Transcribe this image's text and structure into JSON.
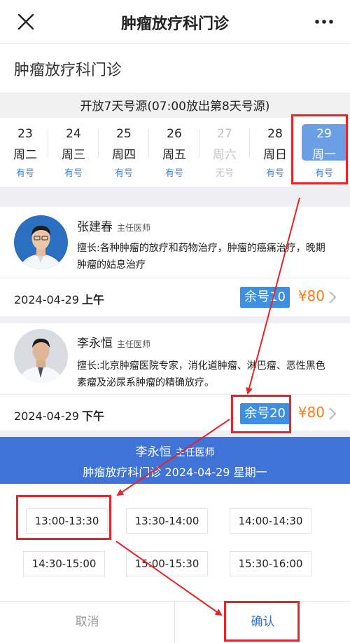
{
  "topbar": {
    "title": "肿瘤放疗科门诊"
  },
  "department": "肿瘤放疗科门诊",
  "notice": "开放7天号源(07:00放出第8天号源)",
  "days": [
    {
      "date": "23",
      "weekday": "周二",
      "status": "有号"
    },
    {
      "date": "24",
      "weekday": "周三",
      "status": "有号"
    },
    {
      "date": "25",
      "weekday": "周四",
      "status": "有号"
    },
    {
      "date": "26",
      "weekday": "周五",
      "status": "有号"
    },
    {
      "date": "27",
      "weekday": "周六",
      "status": "无号"
    },
    {
      "date": "28",
      "weekday": "周日",
      "status": "有号"
    },
    {
      "date": "29",
      "weekday": "周一",
      "status": "有号"
    }
  ],
  "doctors": [
    {
      "name": "张建春",
      "rank": "主任医师",
      "bio": "擅长:各种肿瘤的放疗和药物治疗，肿瘤的癌痛治疗，晚期肿瘤的姑息治疗",
      "date": "2024-04-29",
      "period": "上午",
      "remaining": "余号10",
      "price": "¥80"
    },
    {
      "name": "李永恒",
      "rank": "主任医师",
      "bio": "擅长:北京肿瘤医院专家，消化道肿瘤、淋巴瘤、恶性黑色素瘤及泌尿系肿瘤的精确放疗。",
      "date": "2024-04-29",
      "period": "下午",
      "remaining": "余号20",
      "price": "¥80"
    }
  ],
  "banner": {
    "name": "李永恒",
    "rank": "主任医师",
    "line2": "肿瘤放疗科门诊  2024-04-29  星期一"
  },
  "timeslots": [
    "13:00-13:30",
    "13:30-14:00",
    "14:00-14:30",
    "14:30-15:00",
    "15:00-15:30",
    "15:30-16:00"
  ],
  "bottom": {
    "cancel": "取消",
    "confirm": "确认"
  },
  "colors": {
    "accent": "#3f73d8",
    "price": "#ff7a1a",
    "annotation": "#e8232a",
    "available": "#3d85d8"
  }
}
